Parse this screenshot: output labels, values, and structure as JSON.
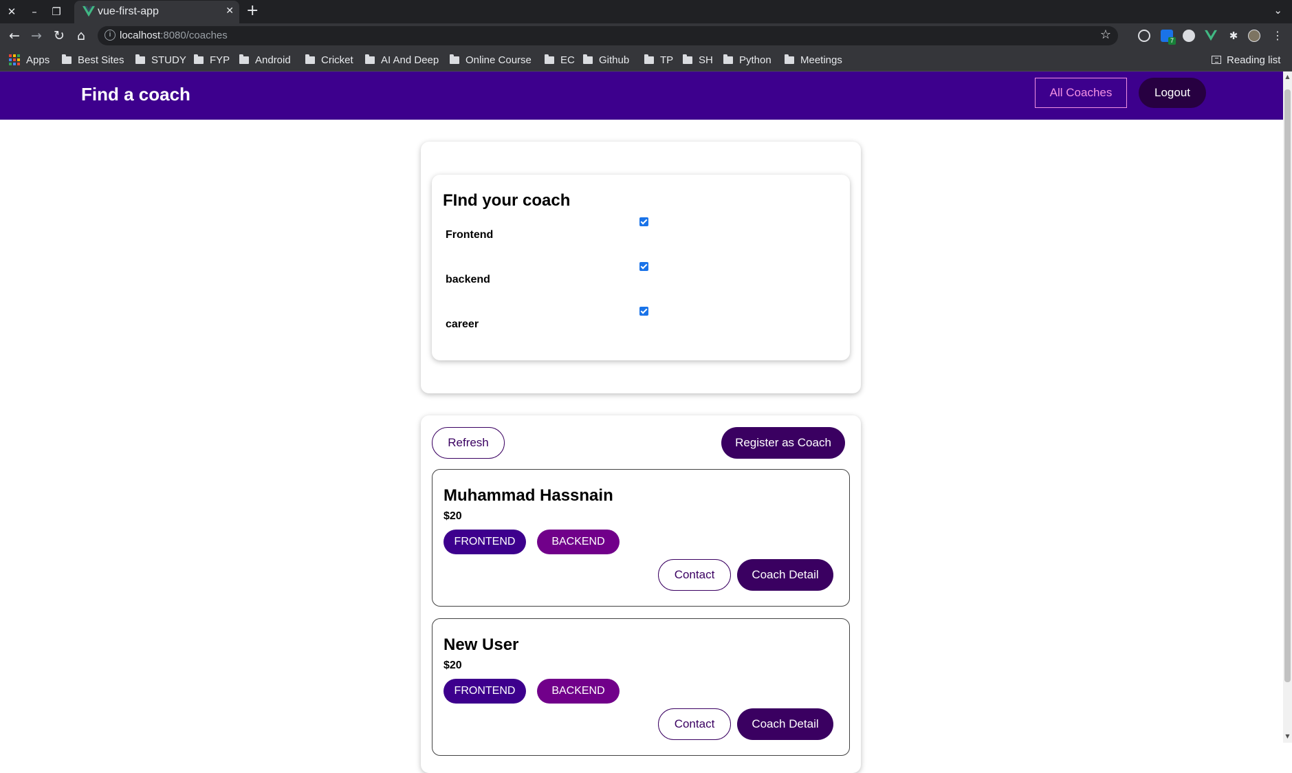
{
  "browser": {
    "tab_title": "vue-first-app",
    "url_host": "localhost",
    "url_path": ":8080/coaches",
    "bookmarks": [
      "Apps",
      "Best Sites",
      "STUDY",
      "FYP",
      "Android",
      "Cricket",
      "AI And Deep",
      "Online Course",
      "EC",
      "Github",
      "TP",
      "SH",
      "Python",
      "Meetings"
    ],
    "reading_list": "Reading list",
    "extension_badge": "7"
  },
  "header": {
    "brand": "Find a coach",
    "all_coaches": "All Coaches",
    "logout": "Logout"
  },
  "filter": {
    "title": "FInd your coach",
    "options": [
      {
        "label": "Frontend",
        "checked": true
      },
      {
        "label": "backend",
        "checked": true
      },
      {
        "label": "career",
        "checked": true
      }
    ]
  },
  "controls": {
    "refresh": "Refresh",
    "register": "Register as Coach"
  },
  "coaches": [
    {
      "name": "Muhammad Hassnain",
      "rate": "$20",
      "areas": [
        "FRONTEND",
        "BACKEND"
      ],
      "contact": "Contact",
      "detail": "Coach Detail"
    },
    {
      "name": "New User",
      "rate": "$20",
      "areas": [
        "FRONTEND",
        "BACKEND"
      ],
      "contact": "Contact",
      "detail": "Coach Detail"
    }
  ],
  "colors": {
    "header_bg": "#3d008d",
    "primary_button": "#3a0061",
    "badge_frontend": "#3d008d",
    "badge_backend": "#71008a",
    "nav_link": "#f391e3"
  }
}
